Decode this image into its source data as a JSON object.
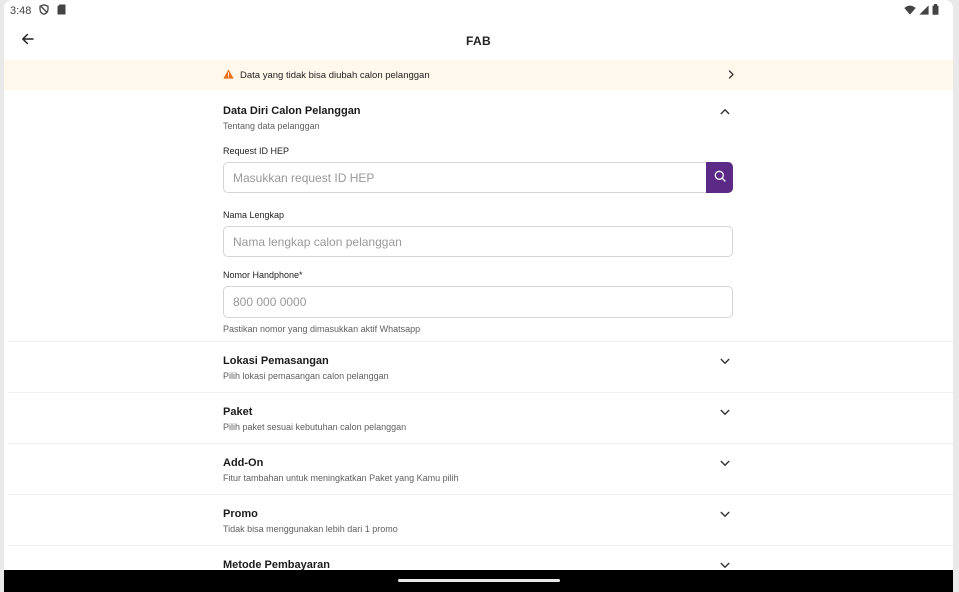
{
  "status_bar": {
    "time": "3:48"
  },
  "app_bar": {
    "title": "FAB"
  },
  "banner": {
    "text": "Data yang tidak bisa diubah calon pelanggan"
  },
  "customer_section": {
    "title": "Data Diri Calon Pelanggan",
    "subtitle": "Tentang data pelanggan",
    "request_id": {
      "label": "Request ID HEP",
      "placeholder": "Masukkan request ID HEP"
    },
    "full_name": {
      "label": "Nama Lengkap",
      "placeholder": "Nama lengkap calon pelanggan"
    },
    "phone": {
      "label": "Nomor Handphone*",
      "placeholder": "800 000 0000",
      "hint": "Pastikan nomor yang dimasukkan aktif Whatsapp"
    }
  },
  "sections": [
    {
      "title": "Lokasi Pemasangan",
      "subtitle": "Pilih lokasi pemasangan calon pelanggan"
    },
    {
      "title": "Paket",
      "subtitle": "Pilih paket sesuai kebutuhan calon pelanggan"
    },
    {
      "title": "Add-On",
      "subtitle": "Fitur tambahan untuk meningkatkan Paket yang Kamu pilih"
    },
    {
      "title": "Promo",
      "subtitle": "Tidak bisa menggunakan lebih dari 1 promo"
    },
    {
      "title": "Metode Pembayaran",
      "subtitle": ""
    }
  ],
  "colors": {
    "accent": "#5b2a86",
    "warning": "#e8701a",
    "banner_bg": "#fff8eb"
  }
}
